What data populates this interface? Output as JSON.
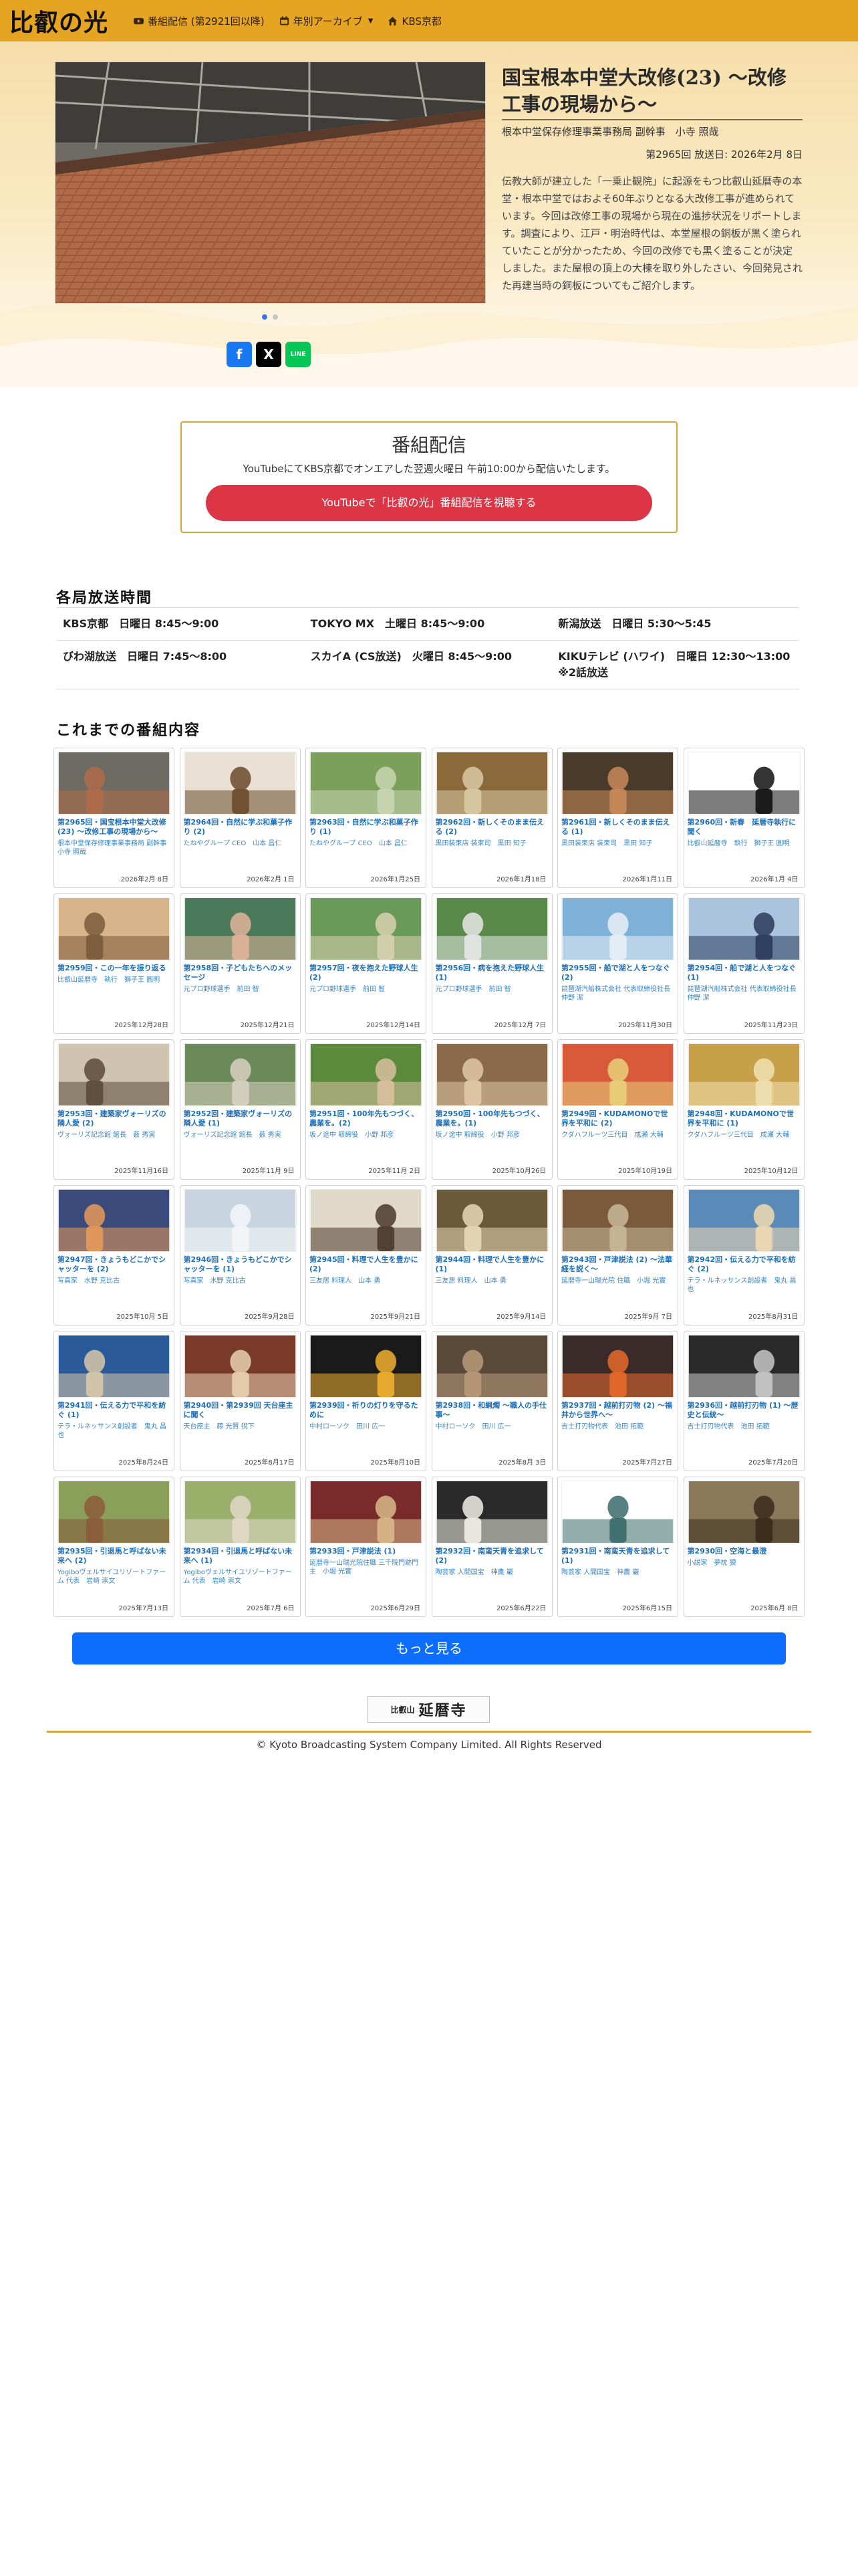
{
  "nav": {
    "brand": "比叡の光",
    "items": [
      {
        "label": "番組配信 (第2921回以降)",
        "icon": "youtube-icon"
      },
      {
        "label": "年別アーカイブ",
        "icon": "calendar-icon"
      },
      {
        "label": "KBS京都",
        "icon": "home-icon"
      }
    ]
  },
  "hero": {
    "title": "国宝根本中堂大改修(23) 〜改修工事の現場から〜",
    "guest": "根本中堂保存修理事業事務局 副幹事　小寺 照哉",
    "episode_date": "第2965回 放送日: 2026年2月 8日",
    "description": "伝教大師が建立した「一乗止観院」に起源をもつ比叡山延暦寺の本堂・根本中堂ではおよそ60年ぶりとなる大改修工事が進められています。今回は改修工事の現場から現在の進捗状況をリポートします。調査により、江戸・明治時代は、本堂屋根の銅板が黒く塗られていたことが分かったため、今回の改修でも黒く塗ることが決定しました。また屋根の頂上の大棟を取り外したさい、今回発見された再建当時の銅板についてもご紹介します。",
    "share": [
      {
        "label": "f",
        "color": "#1877f2"
      },
      {
        "label": "X",
        "color": "#000000"
      },
      {
        "label": "LINE",
        "color": "#06c755"
      }
    ]
  },
  "stream": {
    "heading": "番組配信",
    "note": "YouTubeにてKBS京都でオンエアした翌週火曜日 午前10:00から配信いたします。",
    "button": "YouTubeで「比叡の光」番組配信を視聴する"
  },
  "schedule": {
    "heading": "各局放送時間",
    "rows": [
      [
        "KBS京都　日曜日 8:45〜9:00",
        "TOKYO MX　土曜日 8:45〜9:00",
        "新潟放送　日曜日 5:30〜5:45"
      ],
      [
        "びわ湖放送　日曜日 7:45〜8:00",
        "スカイA (CS放送)　火曜日 8:45〜9:00",
        "KIKUテレビ (ハワイ)　日曜日 12:30〜13:00 ※2話放送"
      ]
    ]
  },
  "episodes": {
    "heading": "これまでの番組内容",
    "items": [
      {
        "title": "第2965回・国宝根本中堂大改修(23) 〜改修工事の現場から〜",
        "guest": "根本中堂保存修理事業事務局 副幹事　小寺 照哉",
        "date": "2026年2月 8日",
        "thumb": "roof"
      },
      {
        "title": "第2964回・自然に学ぶ和菓子作り (2)",
        "guest": "たねやグループ CEO　山本 昌仁",
        "date": "2026年2月 1日",
        "thumb": "sweets"
      },
      {
        "title": "第2963回・自然に学ぶ和菓子作り (1)",
        "guest": "たねやグループ CEO　山本 昌仁",
        "date": "2026年1月25日",
        "thumb": "field"
      },
      {
        "title": "第2962回・新しくそのまま伝える (2)",
        "guest": "黒田装束店 装束司　黒田 知子",
        "date": "2026年1月18日",
        "thumb": "costume"
      },
      {
        "title": "第2961回・新しくそのまま伝える (1)",
        "guest": "黒田装束店 装束司　黒田 知子",
        "date": "2026年1月11日",
        "thumb": "woman"
      },
      {
        "title": "第2960回・新春　延暦寺執行に聞く",
        "guest": "比叡山延暦寺　執行　獅子王 圓明",
        "date": "2026年1月 4日",
        "thumb": "calligraphy"
      },
      {
        "title": "第2959回・この一年を振り返る",
        "guest": "比叡山延暦寺　執行　獅子王 圓明",
        "date": "2025年12月28日",
        "thumb": "talk"
      },
      {
        "title": "第2958回・子どもたちへのメッセージ",
        "guest": "元プロ野球選手　前田 智",
        "date": "2025年12月21日",
        "thumb": "man"
      },
      {
        "title": "第2957回・夜を抱えた野球人生 (2)",
        "guest": "元プロ野球選手　前田 智",
        "date": "2025年12月14日",
        "thumb": "baseball"
      },
      {
        "title": "第2956回・病を抱えた野球人生 (1)",
        "guest": "元プロ野球選手　前田 智",
        "date": "2025年12月 7日",
        "thumb": "team"
      },
      {
        "title": "第2955回・船で湖と人をつなぐ (2)",
        "guest": "琵琶湖汽船株式会社 代表取締役社長　仲野 潔",
        "date": "2025年11月30日",
        "thumb": "lake"
      },
      {
        "title": "第2954回・船で湖と人をつなぐ (1)",
        "guest": "琵琶湖汽船株式会社 代表取締役社長　仲野 潔",
        "date": "2025年11月23日",
        "thumb": "captain"
      },
      {
        "title": "第2953回・建築家ヴォーリズの隣人愛 (2)",
        "guest": "ヴォーリズ記念館 館長　薮 秀実",
        "date": "2025年11月16日",
        "thumb": "room"
      },
      {
        "title": "第2952回・建築家ヴォーリズの隣人愛 (1)",
        "guest": "ヴォーリズ記念館 館長　薮 秀実",
        "date": "2025年11月 9日",
        "thumb": "house"
      },
      {
        "title": "第2951回・100年先もつづく、農業を。(2)",
        "guest": "坂ノ途中 取締役　小野 邦彦",
        "date": "2025年11月 2日",
        "thumb": "group"
      },
      {
        "title": "第2950回・100年先もつづく、農業を。(1)",
        "guest": "坂ノ途中 取締役　小野 邦彦",
        "date": "2025年10月26日",
        "thumb": "man2"
      },
      {
        "title": "第2949回・KUDAMONOで世界を平和に (2)",
        "guest": "クダハフルーツ三代目　成瀬 大輔",
        "date": "2025年10月19日",
        "thumb": "fruit"
      },
      {
        "title": "第2948回・KUDAMONOで世界を平和に (1)",
        "guest": "クダハフルーツ三代目　成瀬 大輔",
        "date": "2025年10月12日",
        "thumb": "fruitshop"
      },
      {
        "title": "第2947回・きょうもどこかでシャッターを (2)",
        "guest": "写真家　水野 克比古",
        "date": "2025年10月 5日",
        "thumb": "sunset"
      },
      {
        "title": "第2946回・きょうもどこかでシャッターを (1)",
        "guest": "写真家　水野 克比古",
        "date": "2025年9月28日",
        "thumb": "snow"
      },
      {
        "title": "第2945回・料理で人生を豊かに (2)",
        "guest": "三友居 料理人　山本 勇",
        "date": "2025年9月21日",
        "thumb": "chef"
      },
      {
        "title": "第2944回・料理で人生を豊かに (1)",
        "guest": "三友居 料理人　山本 勇",
        "date": "2025年9月14日",
        "thumb": "chef2"
      },
      {
        "title": "第2943回・戸津説法 (2) 〜法華経を説く〜",
        "guest": "延暦寺一山瑞光院 住職　小堀 光實",
        "date": "2025年9月 7日",
        "thumb": "temple"
      },
      {
        "title": "第2942回・伝える力で平和を紡ぐ (2)",
        "guest": "テラ・ルネッサンス創設者　鬼丸 昌也",
        "date": "2025年8月31日",
        "thumb": "kids"
      },
      {
        "title": "第2941回・伝える力で平和を紡ぐ (1)",
        "guest": "テラ・ルネッサンス創設者　鬼丸 昌也",
        "date": "2025年8月24日",
        "thumb": "workers"
      },
      {
        "title": "第2940回・第2939回 天台座主に聞く",
        "guest": "天台座主　藤 光賢 猊下",
        "date": "2025年8月17日",
        "thumb": "monk"
      },
      {
        "title": "第2939回・祈りの灯りを守るために",
        "guest": "中村ローソク　田川 広一",
        "date": "2025年8月10日",
        "thumb": "candle"
      },
      {
        "title": "第2938回・和蝋燭 〜職人の手仕事〜",
        "guest": "中村ローソク　田川 広一",
        "date": "2025年8月 3日",
        "thumb": "craft"
      },
      {
        "title": "第2937回・越前打刃物 (2) 〜福井から世界へ〜",
        "guest": "吉士打刃物代表　池田 拓範",
        "date": "2025年7月27日",
        "thumb": "forge"
      },
      {
        "title": "第2936回・越前打刃物 (1) 〜歴史と伝統〜",
        "guest": "吉士打刃物代表　池田 拓範",
        "date": "2025年7月20日",
        "thumb": "knives"
      },
      {
        "title": "第2935回・引退馬と呼ばない未来へ (2)",
        "guest": "Yogiboヴェルサイユリゾートファーム 代表　岩崎 崇文",
        "date": "2025年7月13日",
        "thumb": "horse"
      },
      {
        "title": "第2934回・引退馬と呼ばない未来へ (1)",
        "guest": "Yogiboヴェルサイユリゾートファーム 代表　岩崎 崇文",
        "date": "2025年7月 6日",
        "thumb": "horse2"
      },
      {
        "title": "第2933回・戸津説法 (1)",
        "guest": "延暦寺一山瑞光院住職 三千院門跡門主　小堀 光實",
        "date": "2025年6月29日",
        "thumb": "ceremony"
      },
      {
        "title": "第2932回・南蛮天青を追求して (2)",
        "guest": "陶芸家 人間国宝　神農 巖",
        "date": "2025年6月22日",
        "thumb": "bowl"
      },
      {
        "title": "第2931回・南蛮天青を追求して (1)",
        "guest": "陶芸家 人間国宝　神農 巖",
        "date": "2025年6月15日",
        "thumb": "plate"
      },
      {
        "title": "第2930回・空海と最澄",
        "guest": "小説家　夢枕 獏",
        "date": "2025年6月 8日",
        "thumb": "writer"
      }
    ]
  },
  "more_button": "もっと見る",
  "footer": {
    "logo_small": "比叡山",
    "logo_text": "延暦寺",
    "copyright": "© Kyoto Broadcasting System Company Limited. All Rights Reserved"
  },
  "colors": {
    "navbar": "#e6a423",
    "accent_gold": "#d7a53a",
    "youtube_red": "#dc3545",
    "more_blue": "#0d6efd",
    "link_blue": "#1d6fb8"
  }
}
